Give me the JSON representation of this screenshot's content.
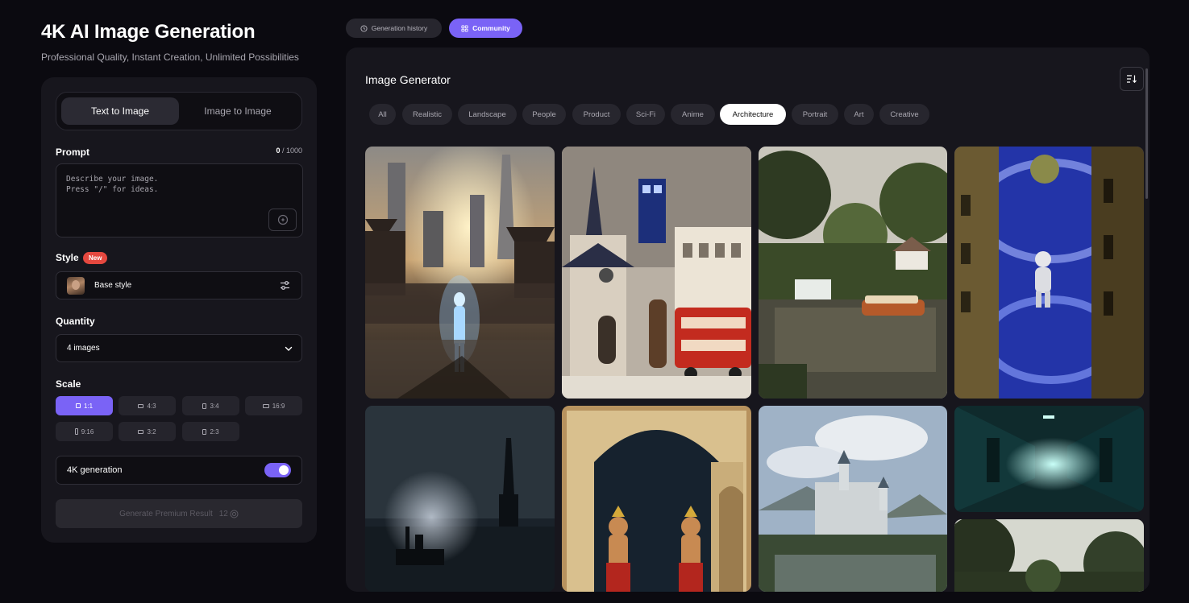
{
  "header": {
    "title": "4K AI Image Generation",
    "subtitle": "Professional Quality, Instant Creation, Unlimited Possibilities"
  },
  "mode_tabs": [
    {
      "label": "Text to Image",
      "active": true
    },
    {
      "label": "Image to Image",
      "active": false
    }
  ],
  "prompt": {
    "label": "Prompt",
    "count": "0",
    "max": " / 1000",
    "placeholder": "Describe your image.\nPress \"/\" for ideas.",
    "value": ""
  },
  "style": {
    "label": "Style",
    "badge": "New",
    "selected": "Base style"
  },
  "quantity": {
    "label": "Quantity",
    "selected": "4 images"
  },
  "scale": {
    "label": "Scale",
    "options": [
      "1:1",
      "4:3",
      "3:4",
      "16:9",
      "9:16",
      "3:2",
      "2:3"
    ],
    "selected": "1:1"
  },
  "k4": {
    "label": "4K generation",
    "enabled": true
  },
  "generate": {
    "label": "Generate Premium Result",
    "cost": "12"
  },
  "top_tabs": [
    {
      "label": "Generation history",
      "icon": "clock-icon",
      "active": false
    },
    {
      "label": "Community",
      "icon": "grid-icon",
      "active": true
    }
  ],
  "gallery": {
    "title": "Image Generator",
    "filters": [
      "All",
      "Realistic",
      "Landscape",
      "People",
      "Product",
      "Sci-Fi",
      "Anime",
      "Architecture",
      "Portrait",
      "Art",
      "Creative"
    ],
    "active_filter": "Architecture"
  },
  "colors": {
    "accent": "#7a63f6",
    "badge": "#e5483f",
    "panel": "#17161d",
    "background": "#0b0a10"
  }
}
